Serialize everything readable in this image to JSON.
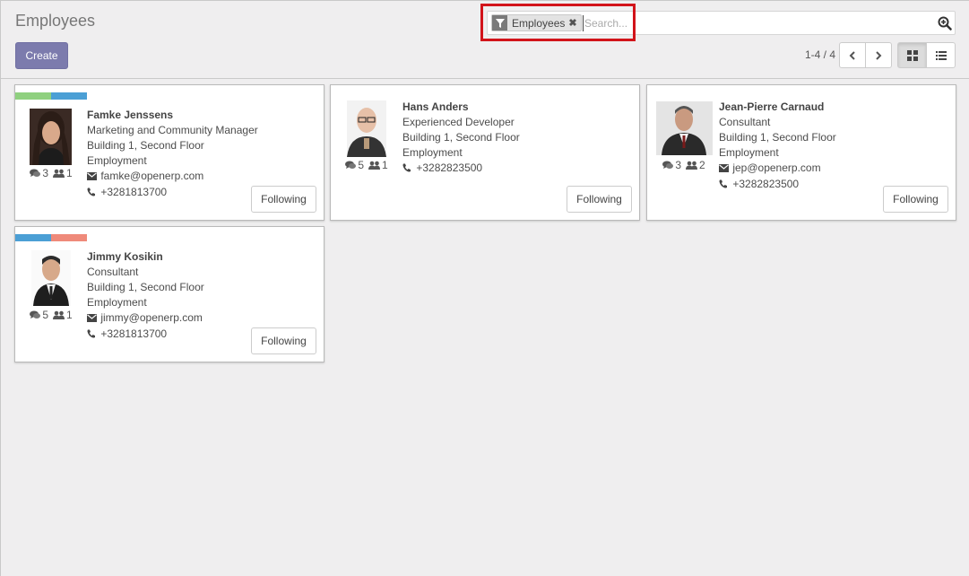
{
  "header": {
    "title": "Employees",
    "create_label": "Create"
  },
  "search": {
    "facet_value": "Employees",
    "placeholder": "Search...",
    "icons": {
      "facet": "filter-icon",
      "remove": "close-icon",
      "button": "search-plus-icon"
    }
  },
  "pager": {
    "value": "1-4 / 4"
  },
  "colors": {
    "brand": "#7c7bad",
    "highlight": "#d2131a",
    "tag_green": "#8fd07f",
    "tag_blue": "#4b9fd5",
    "tag_red": "#ef8a7a"
  },
  "employees": [
    {
      "name": "Famke Jenssens",
      "job": "Marketing and Community Manager",
      "location": "Building 1, Second Floor",
      "category": "Employment",
      "email": "famke@openerp.com",
      "phone": "+3281813700",
      "messages": "3",
      "followers": "1",
      "follow_label": "Following",
      "tags": [
        "#8fd07f",
        "#4b9fd5"
      ]
    },
    {
      "name": "Hans Anders",
      "job": "Experienced Developer",
      "location": "Building 1, Second Floor",
      "category": "Employment",
      "phone": "+3282823500",
      "messages": "5",
      "followers": "1",
      "follow_label": "Following",
      "tags": []
    },
    {
      "name": "Jean-Pierre Carnaud",
      "job": "Consultant",
      "location": "Building 1, Second Floor",
      "category": "Employment",
      "email": "jep@openerp.com",
      "phone": "+3282823500",
      "messages": "3",
      "followers": "2",
      "follow_label": "Following",
      "tags": []
    },
    {
      "name": "Jimmy Kosikin",
      "job": "Consultant",
      "location": "Building 1, Second Floor",
      "category": "Employment",
      "email": "jimmy@openerp.com",
      "phone": "+3281813700",
      "messages": "5",
      "followers": "1",
      "follow_label": "Following",
      "tags": [
        "#4b9fd5",
        "#ef8a7a"
      ]
    }
  ]
}
